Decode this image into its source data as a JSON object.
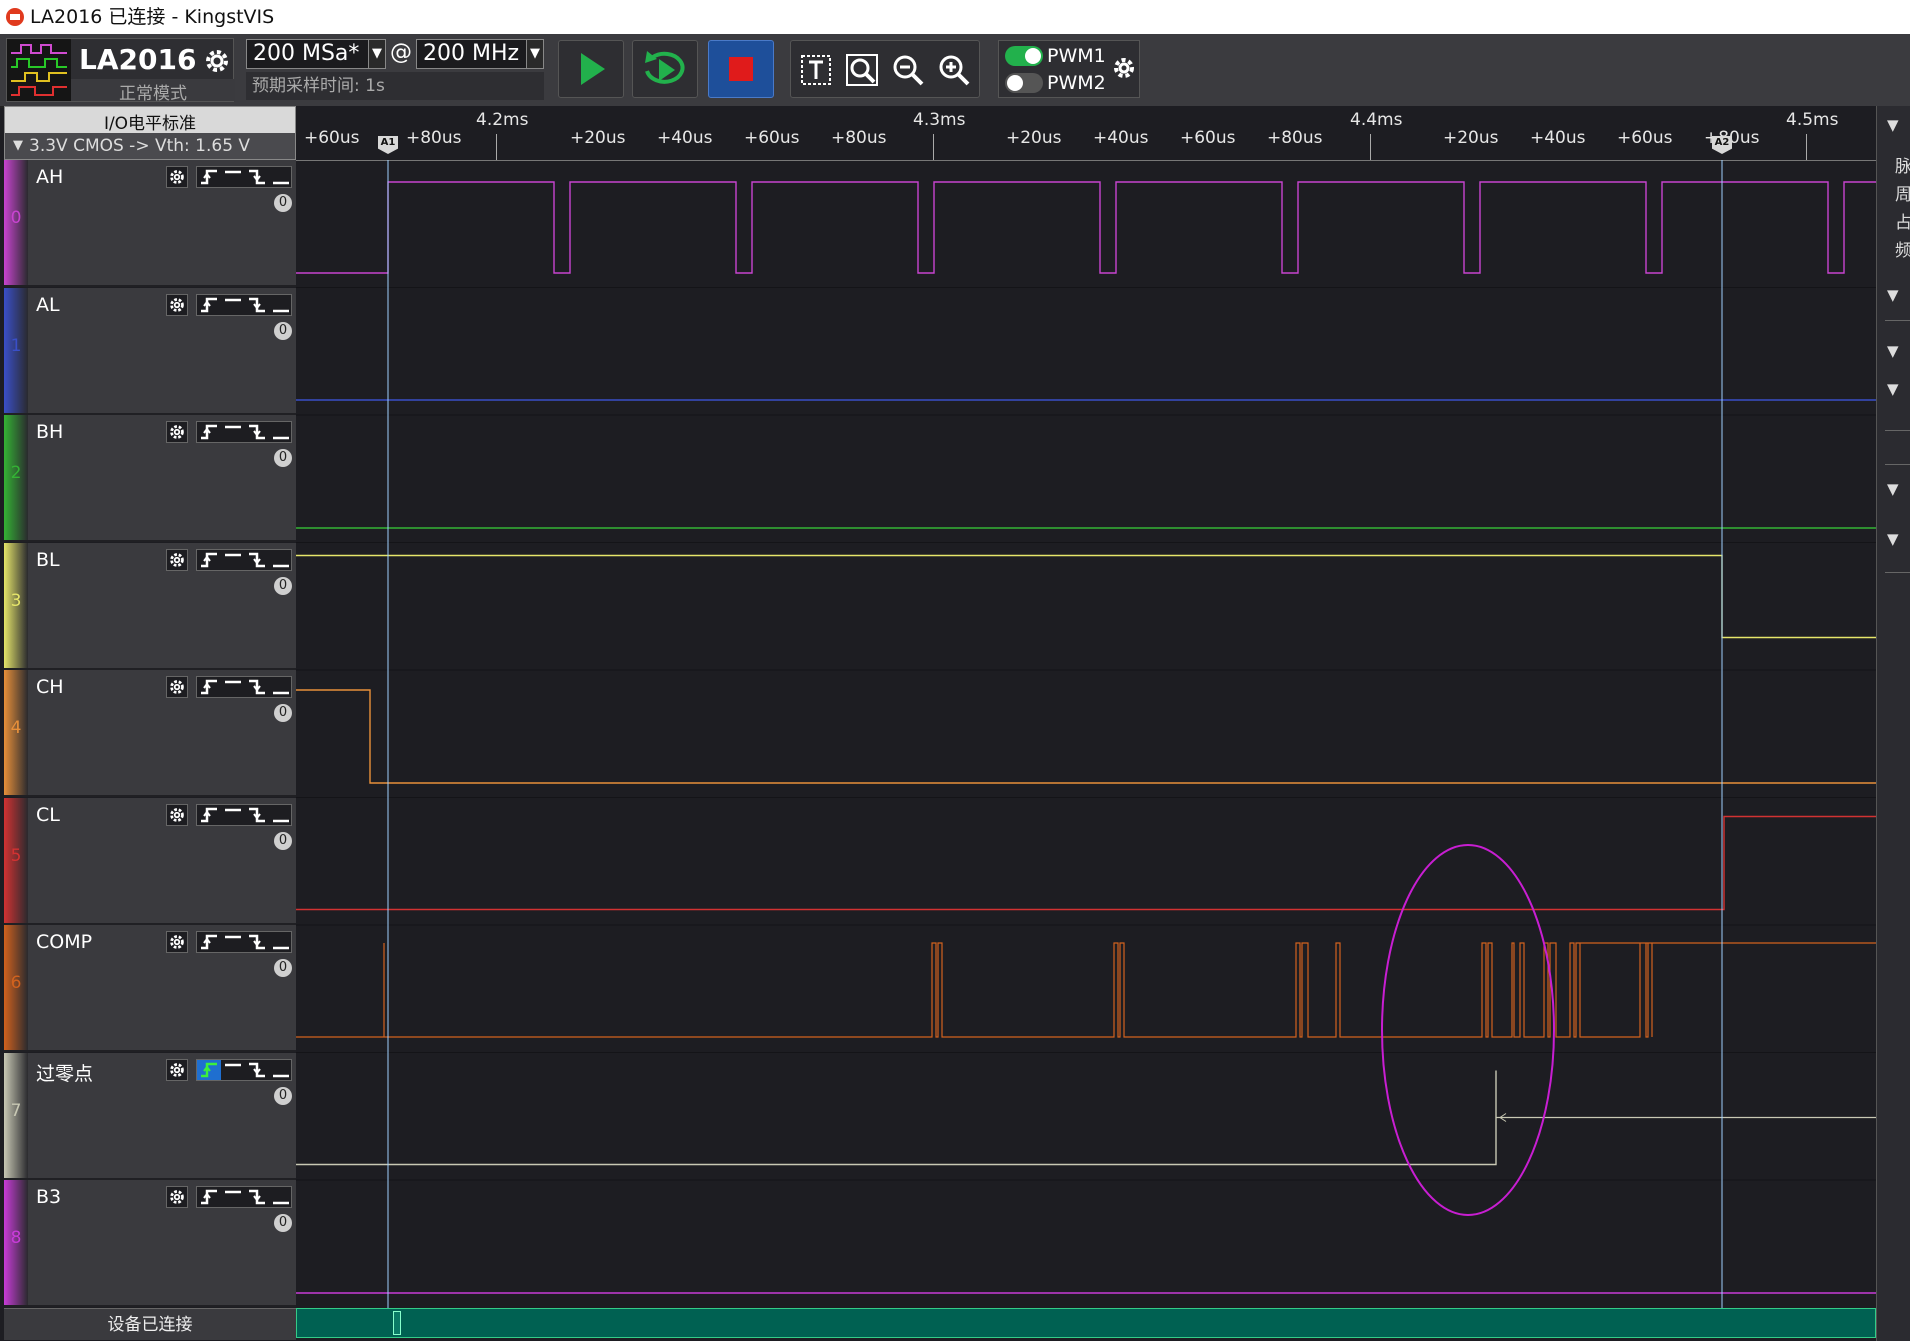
{
  "window": {
    "title": "LA2016 已连接 - KingstVIS"
  },
  "toolbar": {
    "device_name": "LA2016",
    "device_mode": "正常模式",
    "sample_rate": "200 MSa*",
    "at_symbol": "@",
    "sample_freq": "200 MHz",
    "sample_time": "预期采样时间: 1s",
    "pwm1_label": "PWM1",
    "pwm2_label": "PWM2",
    "pwm1_on": true,
    "pwm2_on": false,
    "run_color": "#22b14c",
    "stop_color": "#e01b1b"
  },
  "io_panel": {
    "title": "I/O电平标准",
    "standard": "3.3V CMOS  -> Vth: 1.65 V"
  },
  "channels": [
    {
      "index": "0",
      "name": "AH",
      "count": "0",
      "color": "#c844d0"
    },
    {
      "index": "1",
      "name": "AL",
      "count": "0",
      "color": "#3a4fc8"
    },
    {
      "index": "2",
      "name": "BH",
      "count": "0",
      "color": "#34b334"
    },
    {
      "index": "3",
      "name": "BL",
      "count": "0",
      "color": "#e6e66a"
    },
    {
      "index": "4",
      "name": "CH",
      "count": "0",
      "color": "#e8903a"
    },
    {
      "index": "5",
      "name": "CL",
      "count": "0",
      "color": "#d23232"
    },
    {
      "index": "6",
      "name": "COMP",
      "count": "0",
      "color": "#d2621e"
    },
    {
      "index": "7",
      "name": "过零点",
      "count": "0",
      "color": "#c8c8b4"
    },
    {
      "index": "8",
      "name": "B3",
      "count": "0",
      "color": "#c83cd8"
    }
  ],
  "ruler": {
    "major": [
      "4.2ms",
      "4.3ms",
      "4.4ms",
      "4.5ms"
    ],
    "minor": [
      "+60us",
      "+80us",
      "+20us",
      "+40us",
      "+60us",
      "+80us",
      "+20us",
      "+40us",
      "+60us",
      "+80us",
      "+20us",
      "+40us",
      "+60us",
      "+80us"
    ],
    "marker_a1": "A1",
    "marker_a2": "A2"
  },
  "status": {
    "left_text": "设备已连接"
  },
  "right_panel": {
    "chars": [
      "脉",
      "周",
      "占",
      "频"
    ]
  }
}
